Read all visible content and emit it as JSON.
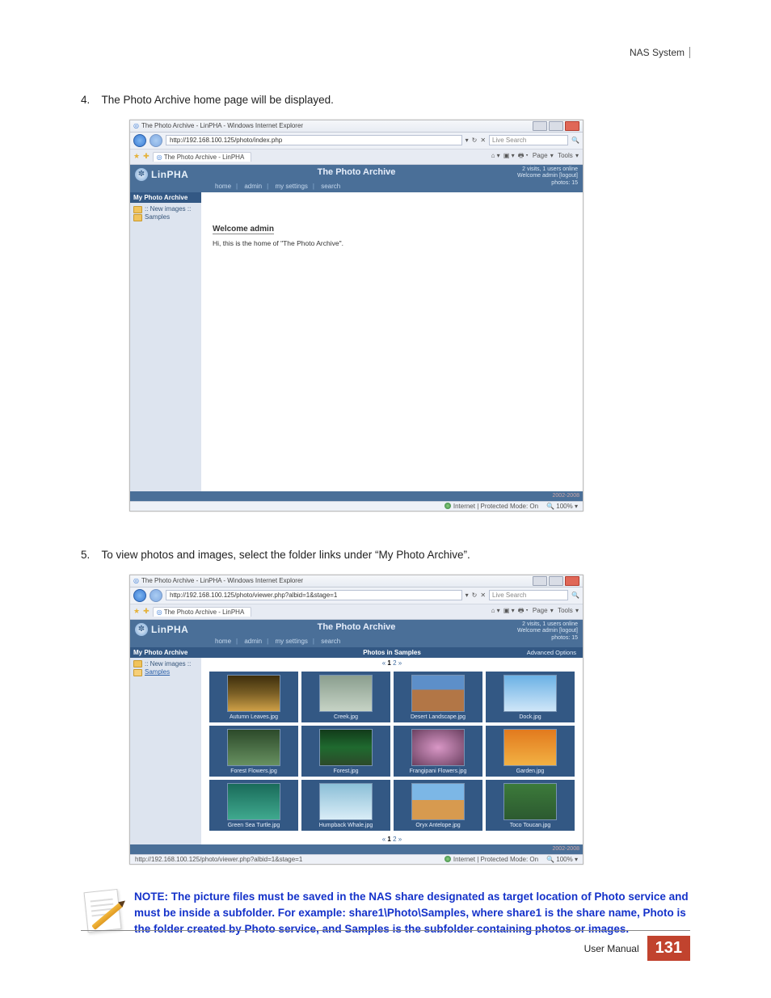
{
  "header": {
    "system": "NAS System"
  },
  "steps": {
    "s4": {
      "num": "4.",
      "text": "The Photo Archive home page will be displayed."
    },
    "s5": {
      "num": "5.",
      "text": "To view photos and images, select the folder links under “My Photo Archive”."
    }
  },
  "ie": {
    "wintitle1": "The Photo Archive - LinPHA - Windows Internet Explorer",
    "wintitle2": "The Photo Archive - LinPHA - Windows Internet Explorer",
    "url1": "http://192.168.100.125/photo/index.php",
    "url2": "http://192.168.100.125/photo/viewer.php?albid=1&stage=1",
    "search_placeholder": "Live Search",
    "tabtitle": "The Photo Archive - LinPHA",
    "tools": {
      "page": "Page",
      "tools": "Tools"
    },
    "status": {
      "zone": "Internet | Protected Mode: On",
      "zoom": "100%",
      "hover": "http://192.168.100.125/photo/viewer.php?albid=1&stage=1"
    }
  },
  "linpha": {
    "brand": "LinPHA",
    "title": "The Photo Archive",
    "corner": {
      "visits": "2 visits, 1 users online",
      "welcome": "Welcome admin",
      "logout": "[logout]",
      "photos": "photos: 15"
    },
    "nav": {
      "home": "home",
      "admin": "admin",
      "settings": "my settings",
      "search": "search"
    },
    "side": {
      "head": "My Photo Archive",
      "new": ":: New images ::",
      "samples": "Samples"
    },
    "welcome_head": "Welcome admin",
    "welcome_text": "Hi, this is the home of \"The Photo Archive\".",
    "footer_years": "2002-2008"
  },
  "gallery": {
    "heading": "Photos in Samples",
    "advanced": "Advanced Options",
    "pager_prev": "«",
    "pager_cur": "1",
    "pager_next": "2",
    "pager_raquo": "»",
    "items": {
      "i1": "Autumn Leaves.jpg",
      "i2": "Creek.jpg",
      "i3": "Desert Landscape.jpg",
      "i4": "Dock.jpg",
      "i5": "Forest Flowers.jpg",
      "i6": "Forest.jpg",
      "i7": "Frangipani Flowers.jpg",
      "i8": "Garden.jpg",
      "i9": "Green Sea Turtle.jpg",
      "i10": "Humpback Whale.jpg",
      "i11": "Oryx Antelope.jpg",
      "i12": "Toco Toucan.jpg"
    }
  },
  "note": {
    "text": "NOTE: The picture files must be saved in the NAS share designated as target location of Photo service and must be inside a subfolder. For example: share1\\Photo\\Samples, where share1 is the share name, Photo is the folder created by Photo service, and Samples is the subfolder containing photos or images."
  },
  "footer": {
    "manual": "User Manual",
    "page": "131"
  }
}
